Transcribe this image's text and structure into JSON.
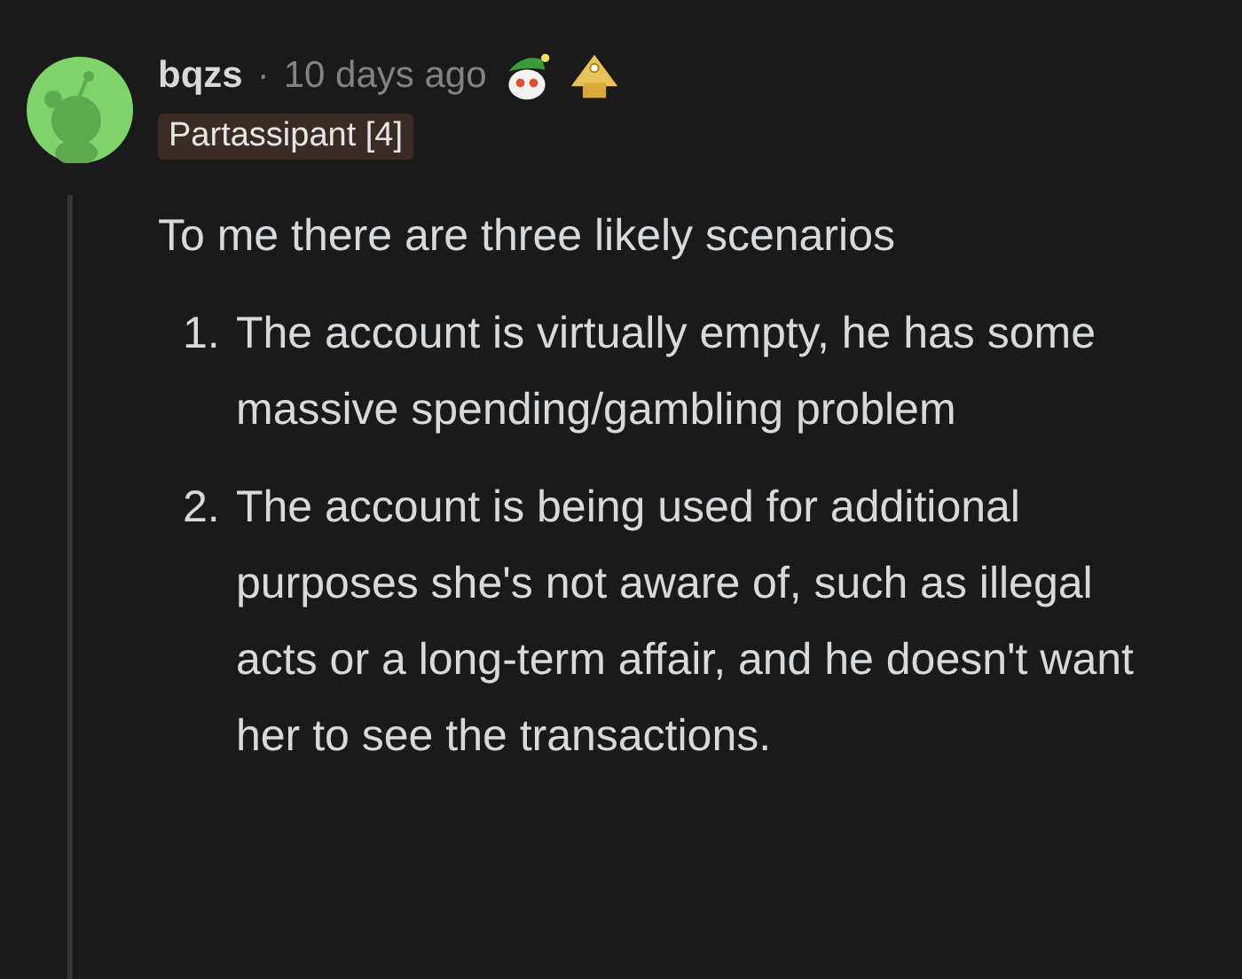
{
  "comment": {
    "author": "bqzs",
    "separator": "·",
    "time": "10 days ago",
    "flair": "Partassipant [4]",
    "body": {
      "intro": "To me there are three likely scenarios",
      "items": [
        {
          "number": "1.",
          "text": "The account is virtually empty, he has some massive spending/gambling problem"
        },
        {
          "number": "2.",
          "text": "The account is being used for additional purposes she's not aware of, such as illegal acts or a long-term affair, and he doesn't want her to see the transactions."
        }
      ]
    }
  }
}
